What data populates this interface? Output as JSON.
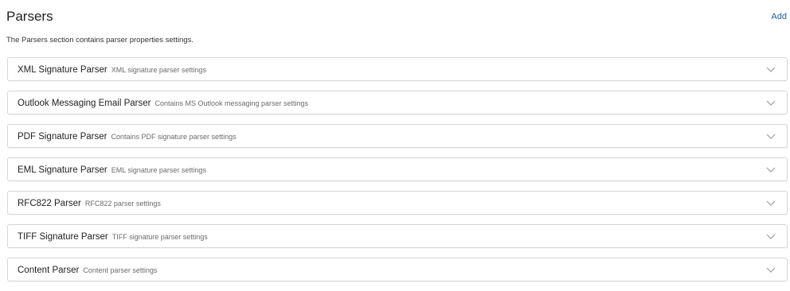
{
  "section": {
    "title": "Parsers",
    "add_label": "Add",
    "description": "The Parsers section contains parser properties settings."
  },
  "parsers": [
    {
      "name": "XML Signature Parser",
      "description": "XML signature parser settings"
    },
    {
      "name": "Outlook Messaging Email Parser",
      "description": "Contains MS Outlook messaging parser settings"
    },
    {
      "name": "PDF Signature Parser",
      "description": "Contains PDF signature parser settings"
    },
    {
      "name": "EML Signature Parser",
      "description": "EML signature parser settings"
    },
    {
      "name": "RFC822 Parser",
      "description": "RFC822 parser settings"
    },
    {
      "name": "TIFF Signature Parser",
      "description": "TIFF signature parser settings"
    },
    {
      "name": "Content Parser",
      "description": "Content parser settings"
    }
  ],
  "icons": {
    "expand": "chevron-down-icon"
  },
  "colors": {
    "link": "#1f5f9e",
    "border": "#d6d6d6",
    "chevron": "#9e9e9e"
  }
}
